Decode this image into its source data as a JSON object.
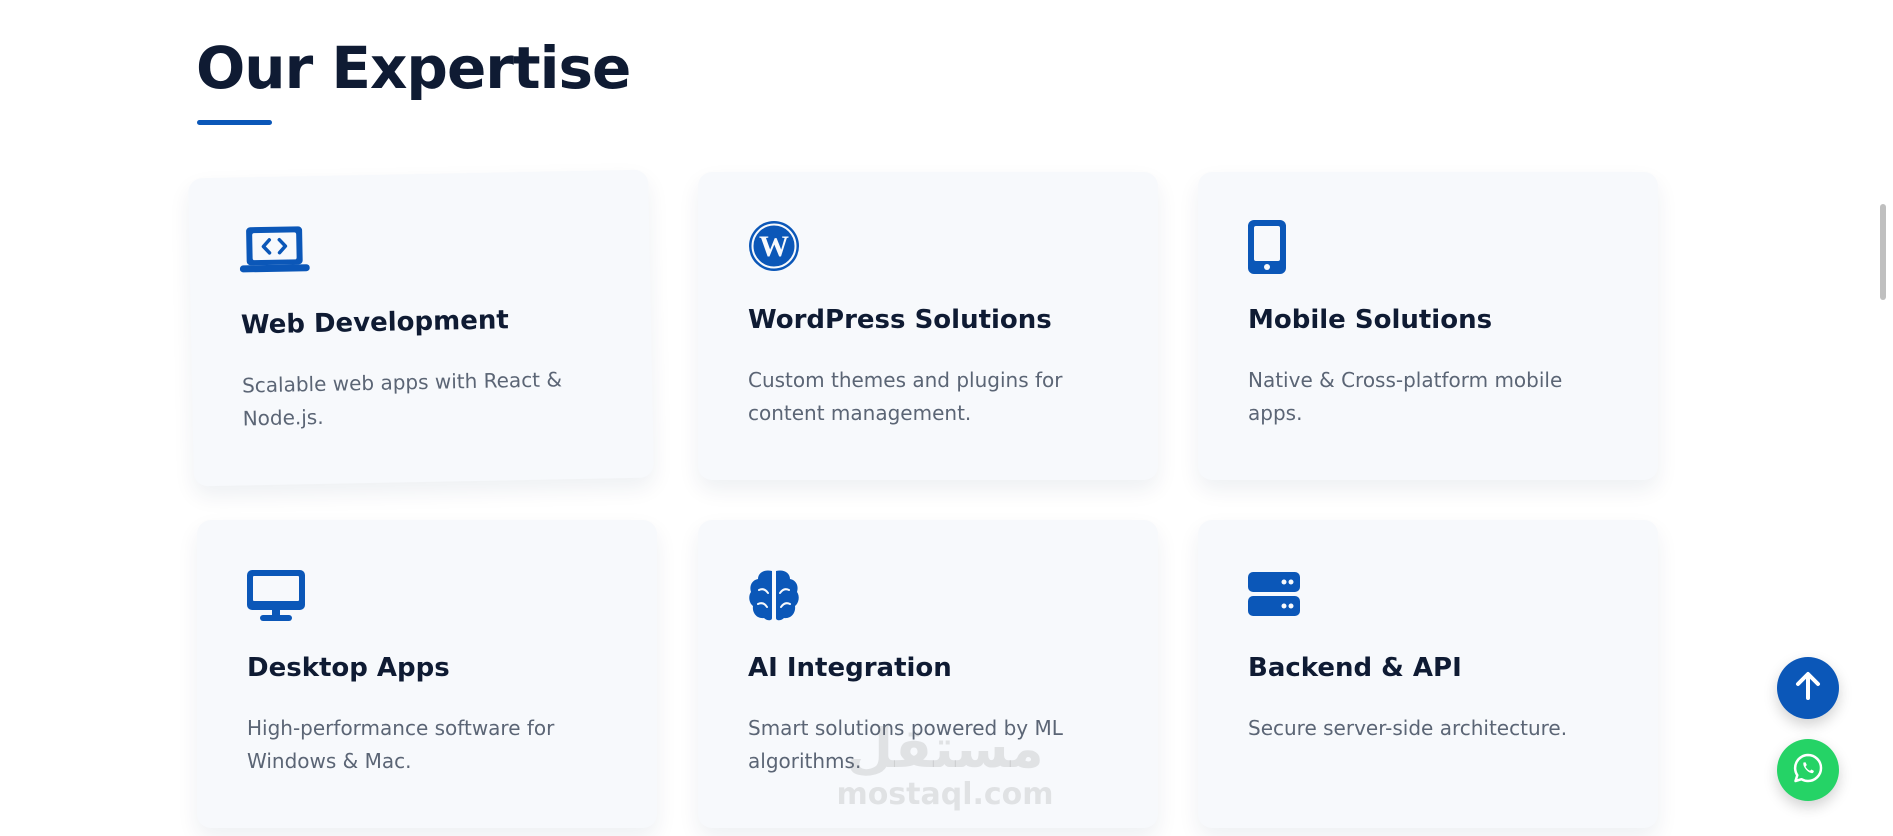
{
  "section": {
    "title": "Our Expertise"
  },
  "accent_color": "#0b57b8",
  "cards": [
    {
      "icon": "code-laptop-icon",
      "title": "Web Development",
      "description": "Scalable web apps with React & Node.js."
    },
    {
      "icon": "wordpress-icon",
      "title": "WordPress Solutions",
      "description": "Custom themes and plugins for content management."
    },
    {
      "icon": "mobile-phone-icon",
      "title": "Mobile Solutions",
      "description": "Native & Cross-platform mobile apps."
    },
    {
      "icon": "desktop-monitor-icon",
      "title": "Desktop Apps",
      "description": "High-performance software for Windows & Mac."
    },
    {
      "icon": "brain-icon",
      "title": "AI Integration",
      "description": "Smart solutions powered by ML algorithms."
    },
    {
      "icon": "server-icon",
      "title": "Backend & API",
      "description": "Secure server-side architecture."
    }
  ],
  "watermark": {
    "arabic": "مستقل",
    "latin": "mostaql.com"
  },
  "floating_buttons": {
    "scroll_top_icon": "arrow-up-icon",
    "whatsapp_icon": "whatsapp-icon",
    "scroll_top_color": "#0b57b8",
    "whatsapp_color": "#25d366"
  }
}
